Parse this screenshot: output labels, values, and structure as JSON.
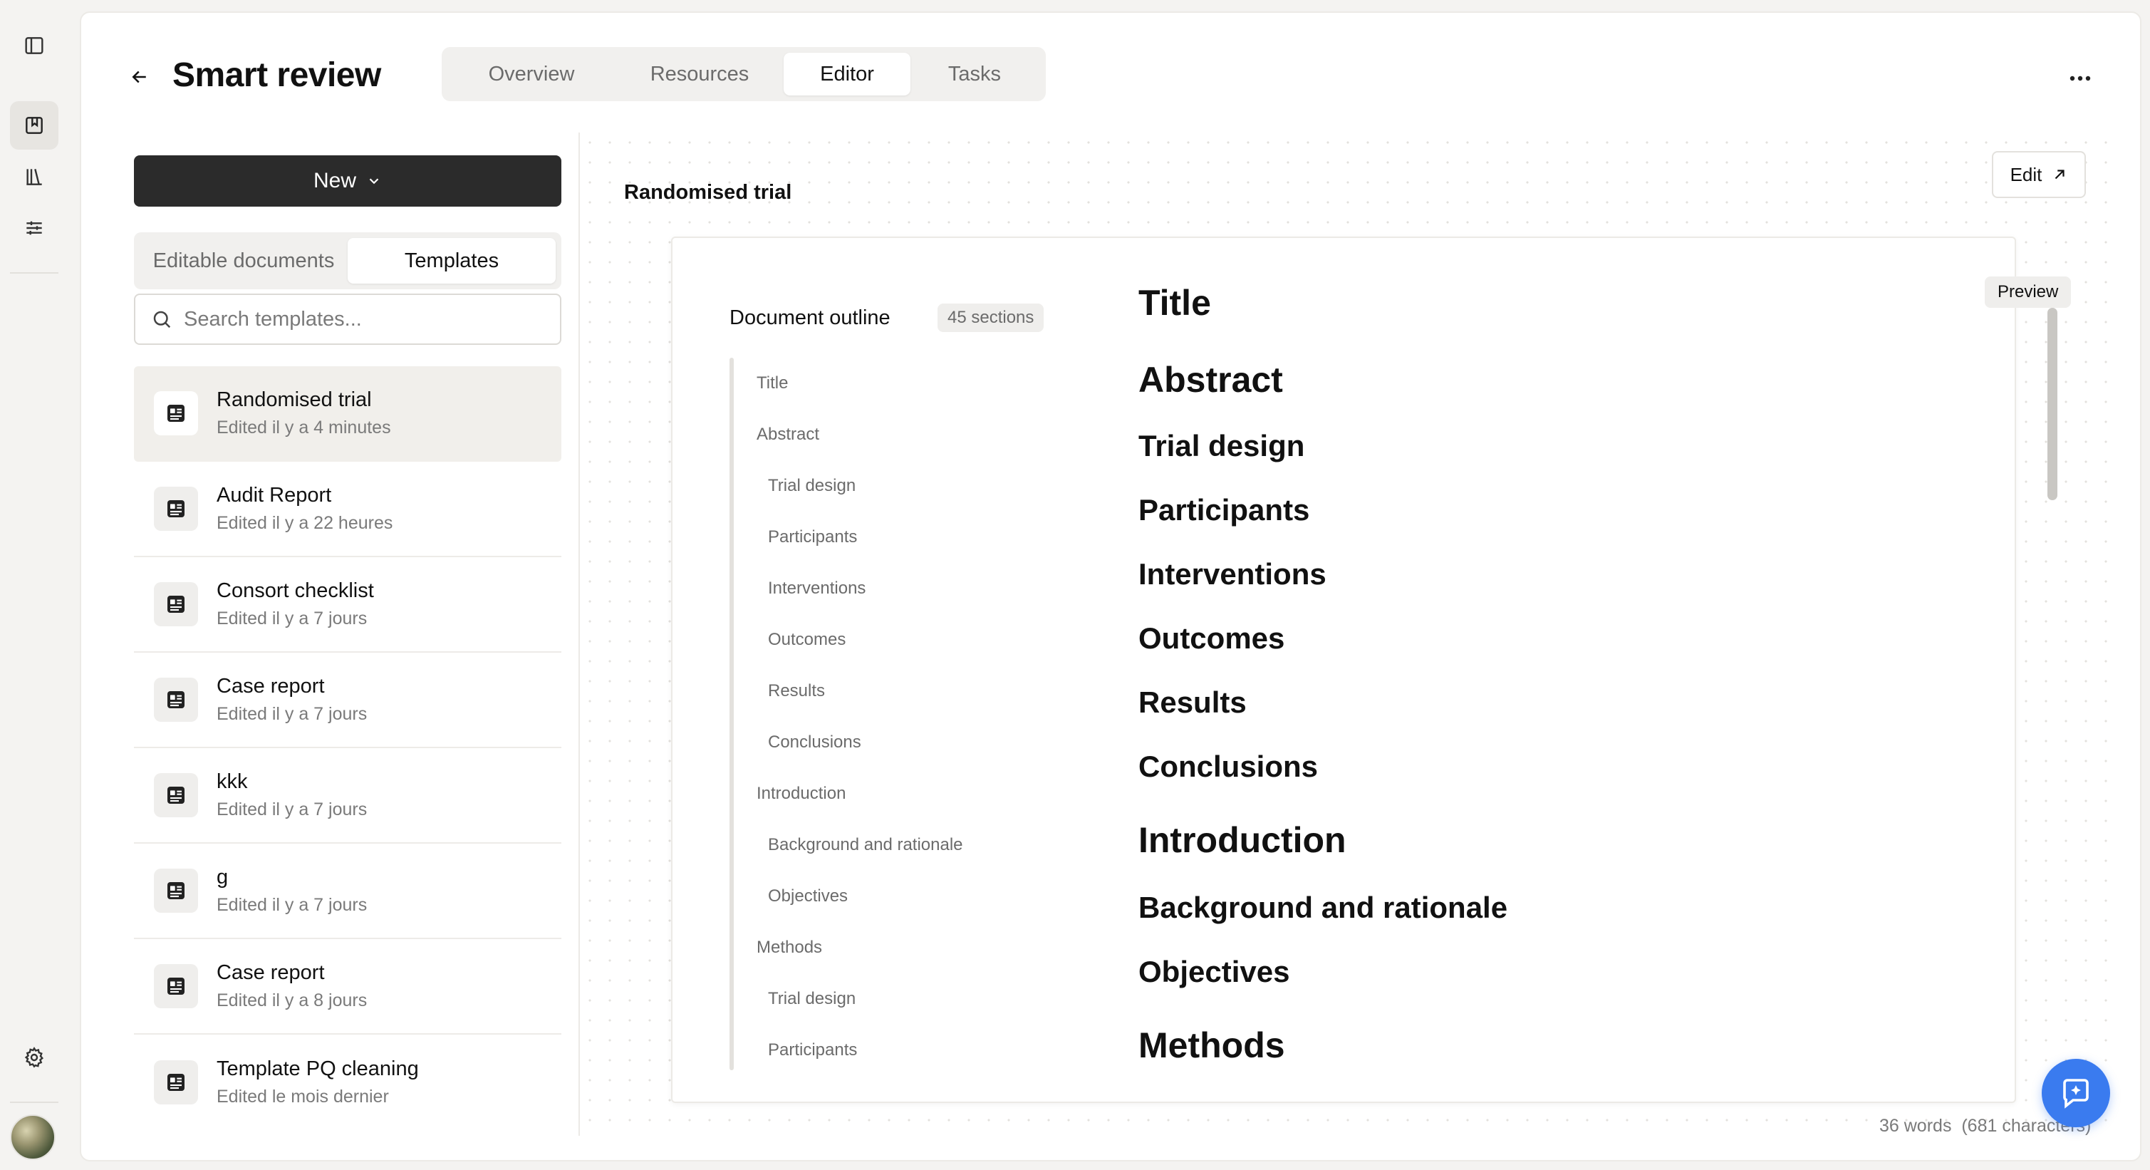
{
  "app": {
    "title": "Smart review"
  },
  "nav_tabs": [
    {
      "label": "Overview",
      "active": false
    },
    {
      "label": "Resources",
      "active": false
    },
    {
      "label": "Editor",
      "active": true
    },
    {
      "label": "Tasks",
      "active": false
    }
  ],
  "rail": {
    "icons": [
      "sidebar-toggle-icon",
      "review-icon",
      "library-icon",
      "sliders-icon",
      "settings-icon",
      "avatar"
    ]
  },
  "left_panel": {
    "new_button": "New",
    "toggle": {
      "editable": "Editable documents",
      "templates": "Templates",
      "active": "templates"
    },
    "search": {
      "placeholder": "Search templates...",
      "value": ""
    },
    "templates": [
      {
        "name": "Randomised trial",
        "meta": "Edited il y a 4 minutes",
        "active": true
      },
      {
        "name": "Audit Report",
        "meta": "Edited il y a 22 heures",
        "active": false
      },
      {
        "name": "Consort checklist",
        "meta": "Edited il y a 7 jours",
        "active": false
      },
      {
        "name": "Case report",
        "meta": "Edited il y a 7 jours",
        "active": false
      },
      {
        "name": "kkk",
        "meta": "Edited il y a 7 jours",
        "active": false
      },
      {
        "name": "g",
        "meta": "Edited il y a 7 jours",
        "active": false
      },
      {
        "name": "Case report",
        "meta": "Edited il y a 8 jours",
        "active": false
      },
      {
        "name": "Template PQ cleaning",
        "meta": "Edited le mois dernier",
        "active": false
      }
    ]
  },
  "document": {
    "name": "Randomised trial",
    "edit_button": "Edit",
    "preview_badge": "Preview",
    "outline_title": "Document outline",
    "sections_badge": "45 sections",
    "outline": [
      {
        "label": "Title",
        "level": 1
      },
      {
        "label": "Abstract",
        "level": 1
      },
      {
        "label": "Trial design",
        "level": 2
      },
      {
        "label": "Participants",
        "level": 2
      },
      {
        "label": "Interventions",
        "level": 2
      },
      {
        "label": "Outcomes",
        "level": 2
      },
      {
        "label": "Results",
        "level": 2
      },
      {
        "label": "Conclusions",
        "level": 2
      },
      {
        "label": "Introduction",
        "level": 1
      },
      {
        "label": "Background and rationale",
        "level": 2
      },
      {
        "label": "Objectives",
        "level": 2
      },
      {
        "label": "Methods",
        "level": 1
      },
      {
        "label": "Trial design",
        "level": 2
      },
      {
        "label": "Participants",
        "level": 2
      }
    ],
    "preview_headings": [
      {
        "text": "Title",
        "level": 1
      },
      {
        "text": "Abstract",
        "level": 1
      },
      {
        "text": "Trial design",
        "level": 2
      },
      {
        "text": "Participants",
        "level": 2
      },
      {
        "text": "Interventions",
        "level": 2
      },
      {
        "text": "Outcomes",
        "level": 2
      },
      {
        "text": "Results",
        "level": 2
      },
      {
        "text": "Conclusions",
        "level": 2
      },
      {
        "text": "Introduction",
        "level": 1
      },
      {
        "text": "Background and rationale",
        "level": 2
      },
      {
        "text": "Objectives",
        "level": 2
      },
      {
        "text": "Methods",
        "level": 1
      }
    ],
    "word_count": "36 words",
    "char_count": "(681 characters)"
  },
  "colors": {
    "accent": "#3a7bef",
    "dark_button": "#2b2b2b",
    "background": "#f4f3f1"
  }
}
